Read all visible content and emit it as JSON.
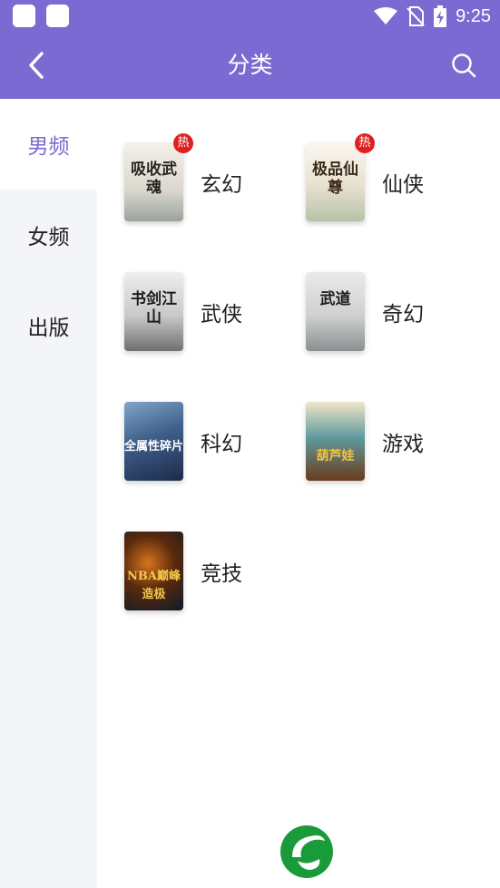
{
  "status_bar": {
    "time": "9:25"
  },
  "header": {
    "title": "分类",
    "back_icon": "chevron-left-icon",
    "search_icon": "search-icon"
  },
  "sidebar": {
    "items": [
      {
        "label": "男频",
        "active": true
      },
      {
        "label": "女频",
        "active": false
      },
      {
        "label": "出版",
        "active": false
      }
    ]
  },
  "categories": [
    {
      "label": "玄幻",
      "badge": "热",
      "cover_text": "吸收武魂"
    },
    {
      "label": "仙侠",
      "badge": "热",
      "cover_text": "极品仙尊"
    },
    {
      "label": "武侠",
      "badge": "",
      "cover_text": "书剑江山"
    },
    {
      "label": "奇幻",
      "badge": "",
      "cover_text": "武道"
    },
    {
      "label": "科幻",
      "badge": "",
      "cover_text": "全属性碎片"
    },
    {
      "label": "游戏",
      "badge": "",
      "cover_text": "葫芦娃"
    },
    {
      "label": "竞技",
      "badge": "",
      "cover_text": "NBA巅峰造极"
    }
  ],
  "colors": {
    "accent": "#7a6ad2",
    "hot_badge": "#e02020",
    "logo_green": "#1a9b3a"
  }
}
